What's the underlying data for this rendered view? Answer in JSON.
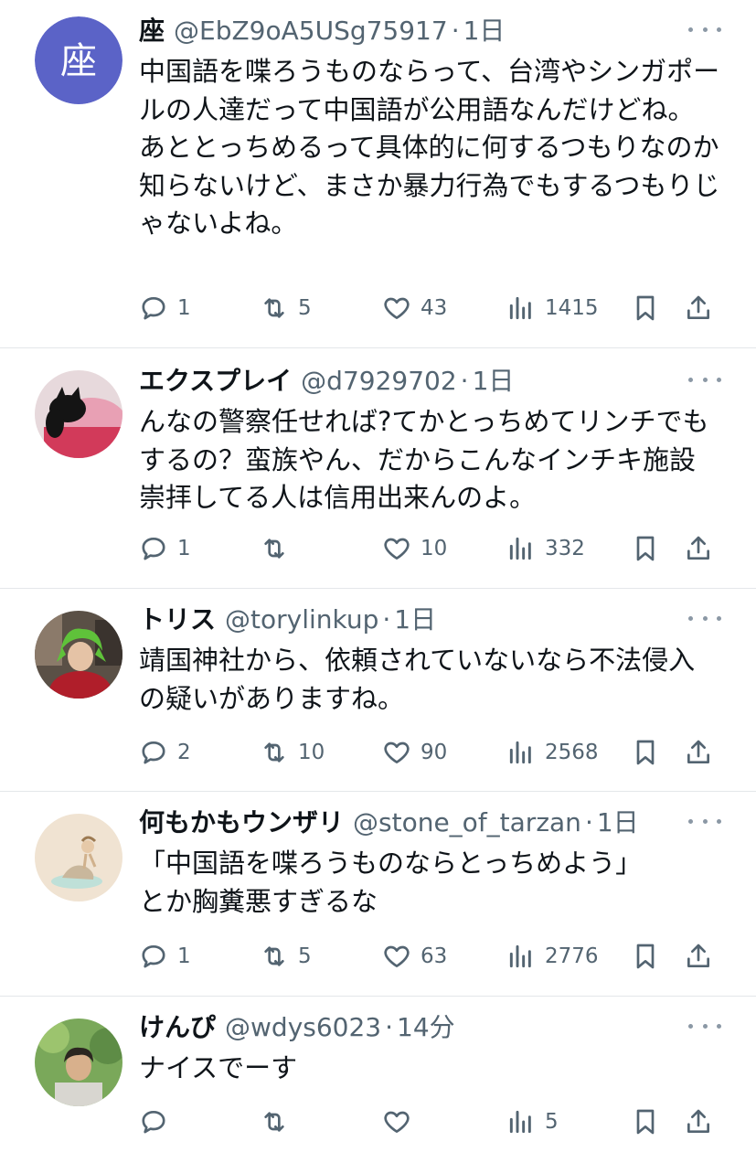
{
  "colors": {
    "text": "#0f1419",
    "secondary": "#536471",
    "divider": "#e4e7ea",
    "avatar_purple": "#5b63c7"
  },
  "tweets": [
    {
      "name": "座",
      "handle": "@EbZ9oA5USg75917",
      "time": "1日",
      "avatar_text": "座",
      "body": "中国語を喋ろうものならって、台湾やシンガポールの人達だって中国語が公用語なんだけどね。\nあととっちめるって具体的に何するつもりなのか知らないけど、まさか暴力行為でもするつもりじゃないよね。",
      "replies": "1",
      "retweets": "5",
      "likes": "43",
      "views": "1415"
    },
    {
      "name": "エクスプレイ",
      "handle": "@d7929702",
      "time": "1日",
      "body": "んなの警察任せれば?てかとっちめてリンチでもするの？蛮族やん、だからこんなインチキ施設崇拝してる人は信用出来んのよ。",
      "replies": "1",
      "retweets": "",
      "likes": "10",
      "views": "332"
    },
    {
      "name": "トリス",
      "handle": "@torylinkup",
      "time": "1日",
      "body": "靖国神社から、依頼されていないなら不法侵入の疑いがありますね。",
      "replies": "2",
      "retweets": "10",
      "likes": "90",
      "views": "2568"
    },
    {
      "name": "何もかもウンザリ",
      "handle": "@stone_of_tarzan",
      "time": "1日",
      "body": "「中国語を喋ろうものならとっちめよう」\nとか胸糞悪すぎるな",
      "replies": "1",
      "retweets": "5",
      "likes": "63",
      "views": "2776"
    },
    {
      "name": "けんぴ",
      "handle": "@wdys6023",
      "time": "14分",
      "body": "ナイスでーす",
      "replies": "",
      "retweets": "",
      "likes": "",
      "views": "5"
    }
  ],
  "icons": {
    "reply": "reply-icon",
    "retweet": "retweet-icon",
    "like": "heart-icon",
    "views": "views-icon",
    "bookmark": "bookmark-icon",
    "share": "share-icon",
    "more": "more-icon"
  }
}
